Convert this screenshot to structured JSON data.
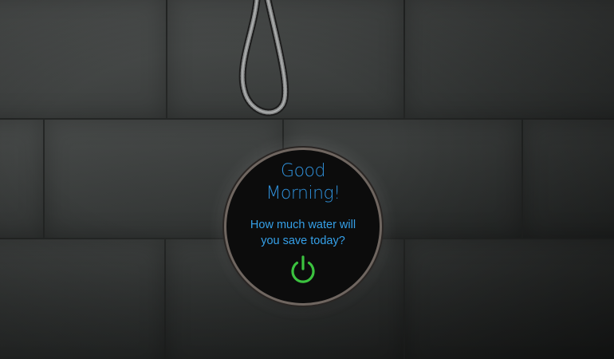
{
  "display": {
    "greeting_line1": "Good",
    "greeting_line2": "Morning!",
    "prompt_line1": "How much water will",
    "prompt_line2": "you save today?",
    "power_icon": "power-icon"
  },
  "colors": {
    "greeting_text": "#2f8fd8",
    "prompt_text": "#35a0e8",
    "power_button": "#3bc23f",
    "screen_background": "#0c0c0c"
  }
}
